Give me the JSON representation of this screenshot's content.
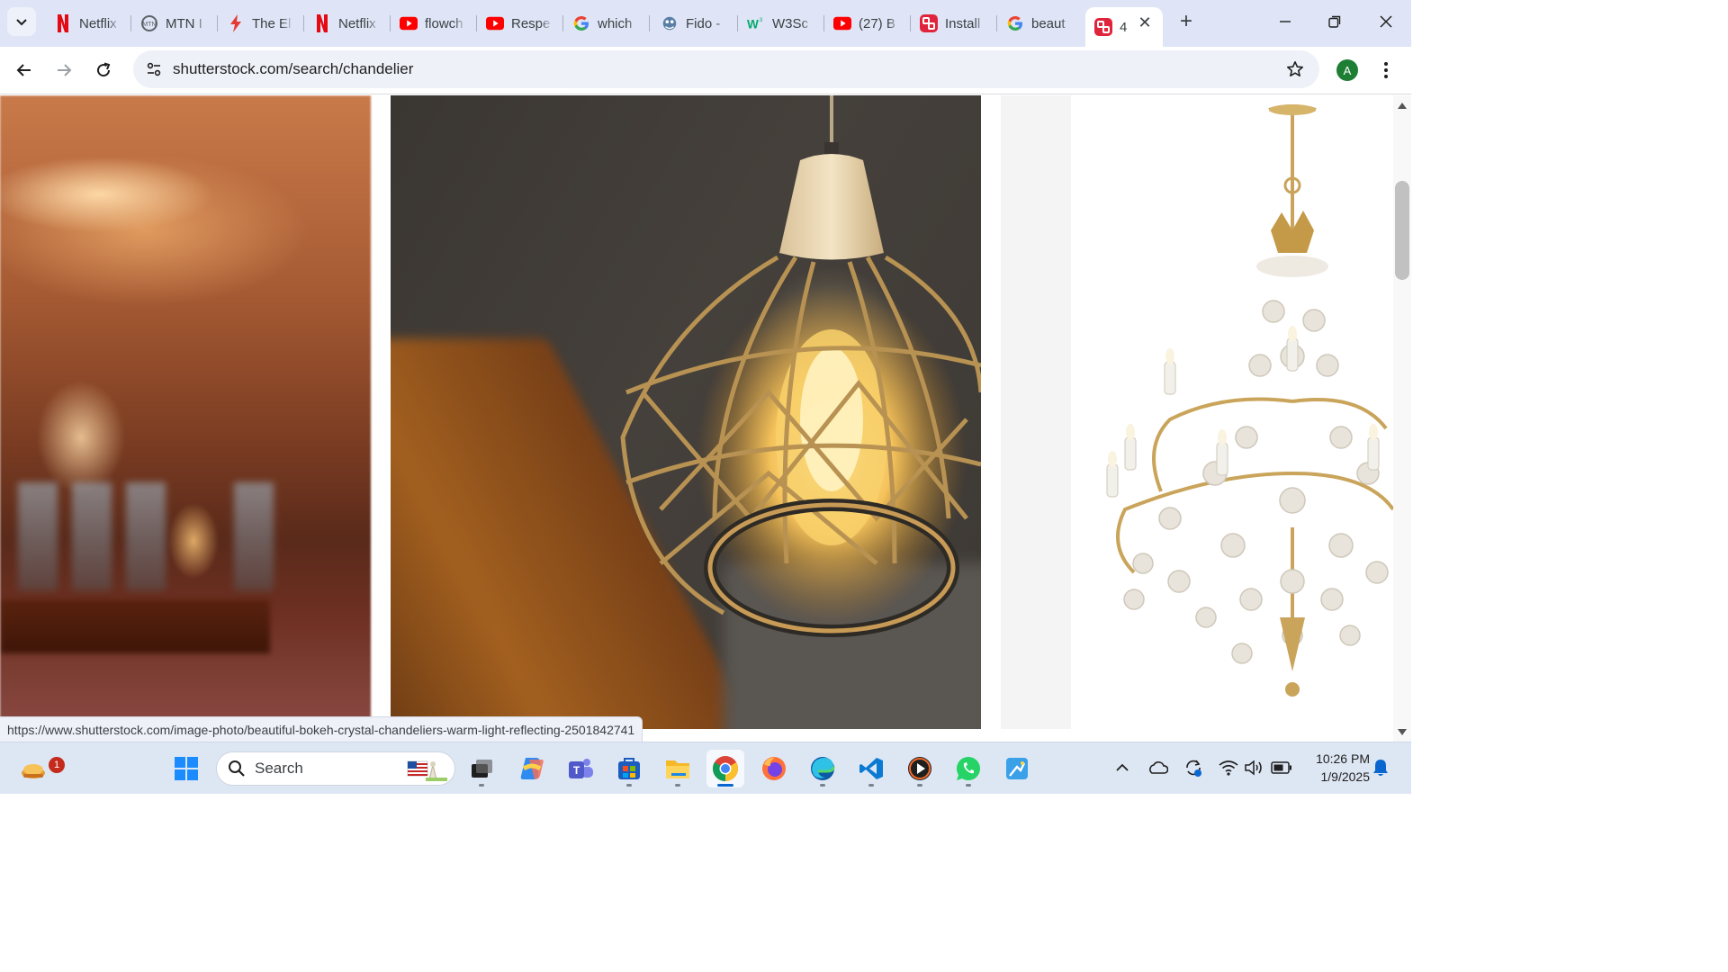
{
  "browser": {
    "tabs": [
      {
        "label": "Netflix",
        "icon": "netflix-icon"
      },
      {
        "label": "MTN I",
        "icon": "mtn-icon"
      },
      {
        "label": "The El",
        "icon": "bolt-icon"
      },
      {
        "label": "Netflix",
        "icon": "netflix-icon"
      },
      {
        "label": "flowch",
        "icon": "youtube-icon"
      },
      {
        "label": "Respe",
        "icon": "youtube-icon"
      },
      {
        "label": "which",
        "icon": "google-icon"
      },
      {
        "label": "Fido -",
        "icon": "fido-icon"
      },
      {
        "label": "W3Sc",
        "icon": "w3schools-icon"
      },
      {
        "label": "(27) B",
        "icon": "youtube-icon"
      },
      {
        "label": "Install",
        "icon": "shutterstock-icon"
      },
      {
        "label": "beaut",
        "icon": "google-icon"
      },
      {
        "label": "4",
        "icon": "shutterstock-icon",
        "active": true
      }
    ],
    "address": "shutterstock.com/search/chandelier",
    "profile_initial": "A"
  },
  "content": {
    "status_url": "https://www.shutterstock.com/image-photo/beautiful-bokeh-crystal-chandeliers-warm-light-reflecting-2501842741"
  },
  "taskbar": {
    "search_placeholder": "Search",
    "notification_badge": "1",
    "time": "10:26 PM",
    "date": "1/9/2025",
    "apps": [
      "widgets-icon",
      "windows-start-icon",
      "search",
      "file-explorer-dark-icon",
      "copilot-icon",
      "teams-icon",
      "microsoft-store-icon",
      "file-explorer-icon",
      "chrome-icon",
      "firefox-icon",
      "edge-icon",
      "vscode-icon",
      "media-player-icon",
      "whatsapp-icon",
      "paint-icon"
    ]
  },
  "colors": {
    "tab_strip": "#dfe5f6",
    "omnibox": "#eef1f8",
    "taskbar": "#dde6f3",
    "avatar": "#1e7e34",
    "shutterstock_red": "#e0243c"
  }
}
